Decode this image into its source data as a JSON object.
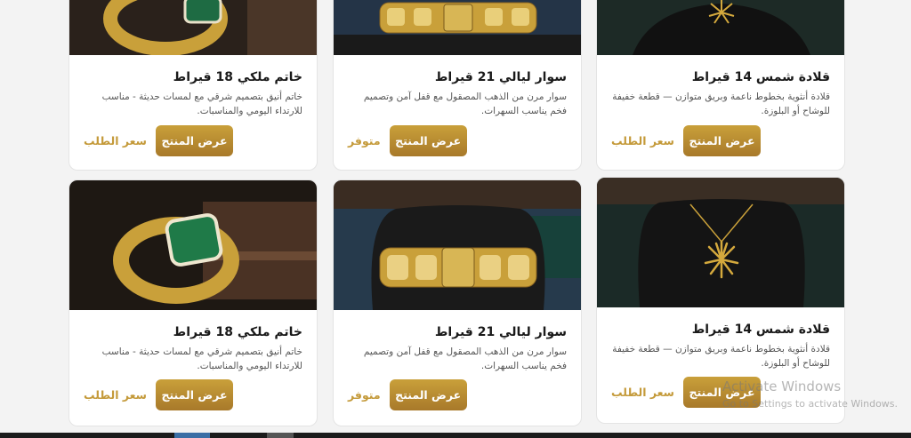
{
  "products": [
    {
      "title": "قلادة شمس 14 قيراط",
      "desc": "قلادة أنثوية بخطوط ناعمة وبريق متوازن — قطعة خفيفة للوشاح أو البلوزة.",
      "button": "عرض المنتج",
      "price": "سعر الطلب",
      "image": "sun-necklace"
    },
    {
      "title": "سوار ليالي 21 قيراط",
      "desc": "سوار مرن من الذهب المصقول مع قفل آمن وتصميم فخم يناسب السهرات.",
      "button": "عرض المنتج",
      "price": "متوفر",
      "image": "gold-bracelet"
    },
    {
      "title": "خاتم ملكي 18 قيراط",
      "desc": "خاتم أنيق بتصميم شرقي مع لمسات حديثة - مناسب للارتداء اليومي والمناسبات.",
      "button": "عرض المنتج",
      "price": "سعر الطلب",
      "image": "emerald-ring"
    },
    {
      "title": "قلادة شمس 14 قيراط",
      "desc": "قلادة أنثوية بخطوط ناعمة وبريق متوازن — قطعة خفيفة للوشاح أو البلوزة.",
      "button": "عرض المنتج",
      "price": "سعر الطلب",
      "image": "sun-necklace"
    },
    {
      "title": "سوار ليالي 21 قيراط",
      "desc": "سوار مرن من الذهب المصقول مع قفل آمن وتصميم فخم يناسب السهرات.",
      "button": "عرض المنتج",
      "price": "متوفر",
      "image": "gold-bracelet"
    },
    {
      "title": "خاتم ملكي 18 قيراط",
      "desc": "خاتم أنيق بتصميم شرقي مع لمسات حديثة - مناسب للارتداء اليومي والمناسبات.",
      "button": "عرض المنتج",
      "price": "سعر الطلب",
      "image": "emerald-ring"
    }
  ],
  "watermark": {
    "line1": "Activate Windows",
    "line2": "Go to Settings to activate Windows."
  },
  "colors": {
    "gold": "#c49a3a",
    "button_top": "#c9a03a",
    "button_bottom": "#a8792a"
  }
}
